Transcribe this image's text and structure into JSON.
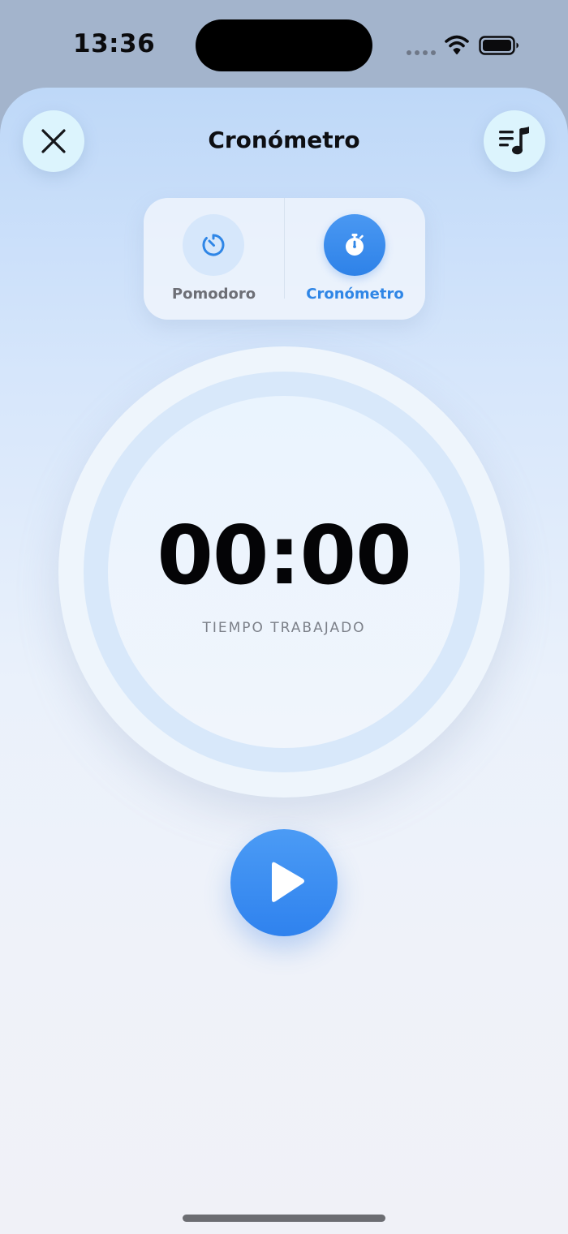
{
  "status_bar": {
    "time": "13:36",
    "icons": [
      "signal-dots-icon",
      "wifi-icon",
      "battery-icon"
    ]
  },
  "header": {
    "title": "Cronómetro",
    "close_icon": "close-icon",
    "music_icon": "music-queue-icon"
  },
  "mode_selector": {
    "options": [
      {
        "label": "Pomodoro",
        "icon": "timer-icon",
        "selected": false
      },
      {
        "label": "Cronómetro",
        "icon": "stopwatch-icon",
        "selected": true
      }
    ]
  },
  "timer": {
    "value": "00:00",
    "caption": "TIEMPO TRABAJADO"
  },
  "controls": {
    "play_icon": "play-icon"
  },
  "colors": {
    "accent": "#2F86E6",
    "title_text": "#0D0E12",
    "muted_text": "#7C8089"
  }
}
